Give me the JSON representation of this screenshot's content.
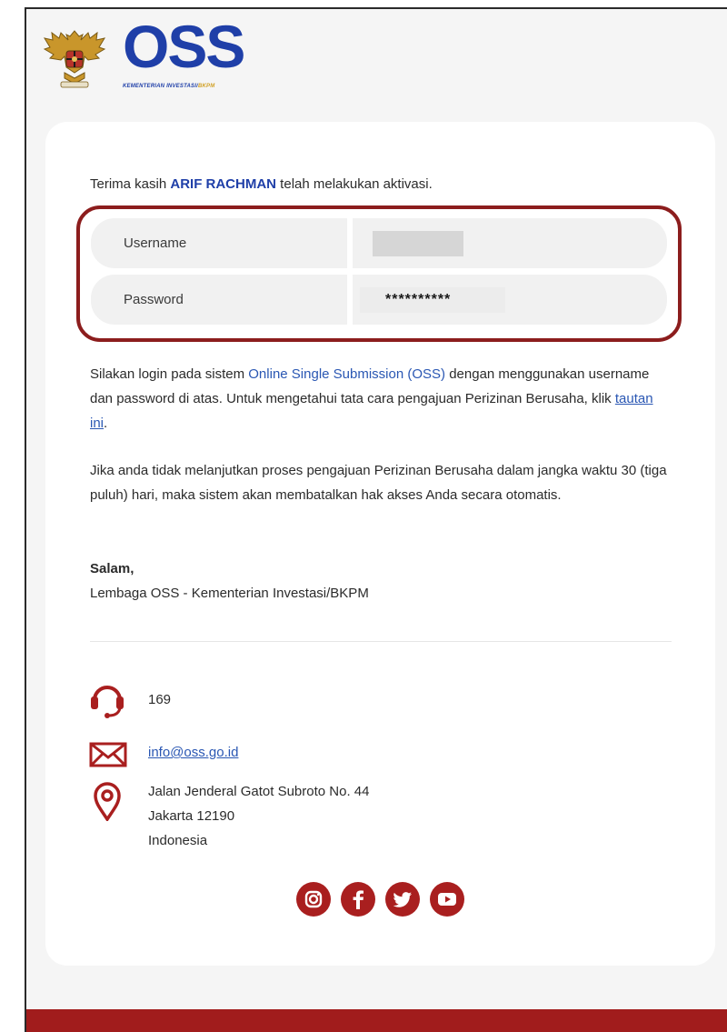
{
  "header": {
    "logo_text": "OSS",
    "logo_subtitle_main": "KEMENTERIAN INVESTASI/",
    "logo_subtitle_highlight": "BKPM"
  },
  "greeting": {
    "prefix": "Terima kasih ",
    "name": "ARIF RACHMAN",
    "suffix": " telah melakukan aktivasi."
  },
  "credentials": {
    "username_label": "Username",
    "password_label": "Password",
    "password_value": "**********"
  },
  "instructions": {
    "before_link": "Silakan login pada sistem ",
    "system_name": "Online Single Submission (OSS)",
    "middle": " dengan menggunakan username dan password di atas. Untuk mengetahui tata cara pengajuan Perizinan Berusaha, klik ",
    "link_text": "tautan ini",
    "after_link": "."
  },
  "notice": "Jika anda tidak melanjutkan proses pengajuan Perizinan Berusaha dalam jangka waktu 30 (tiga puluh) hari, maka sistem akan membatalkan hak akses Anda secara otomatis.",
  "signature": {
    "salutation": "Salam,",
    "organization": "Lembaga OSS - Kementerian Investasi/BKPM"
  },
  "contact": {
    "phone": "169",
    "email": "info@oss.go.id",
    "address_line1": "Jalan Jenderal Gatot Subroto No. 44",
    "address_line2": "Jakarta 12190",
    "address_line3": "Indonesia"
  },
  "social": [
    "instagram-icon",
    "facebook-icon",
    "twitter-icon",
    "youtube-icon"
  ],
  "colors": {
    "brand_blue": "#1f3fa8",
    "accent_red": "#a91f1f",
    "link_blue": "#2a57b3"
  }
}
